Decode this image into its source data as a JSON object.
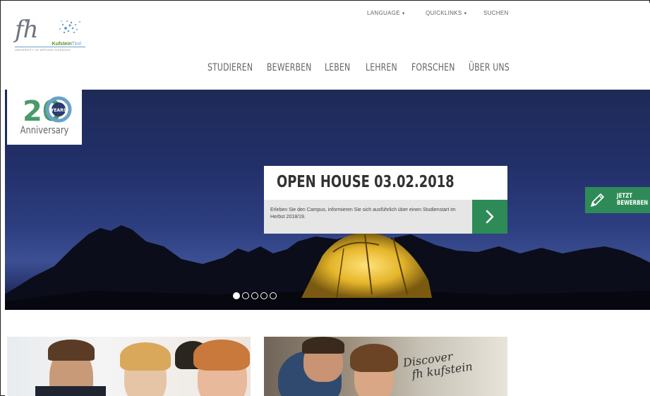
{
  "logo": {
    "mark": "fh",
    "brand_name": "Kufstein",
    "brand_region": "Tirol",
    "tagline": "UNIVERSITY OF APPLIED SCIENCES"
  },
  "utility_nav": {
    "language": "LANGUAGE",
    "quicklinks": "QUICKLINKS",
    "search": "SUCHEN",
    "dropdown_glyph": "▾"
  },
  "main_nav": [
    "STUDIEREN",
    "BEWERBEN",
    "LEBEN",
    "LEHREN",
    "FORSCHEN",
    "ÜBER UNS"
  ],
  "anniversary": {
    "number": "20",
    "years": "YEARS",
    "label": "Anniversary"
  },
  "promo": {
    "title": "OPEN HOUSE 03.02.2018",
    "text": "Erleben Sie den Campus, informieren Sie sich ausführlich über einen Studienstart im Herbst 2018/19.",
    "arrow_icon": "chevron-right-icon"
  },
  "apply_button": {
    "line1": "JETZT",
    "line2": "BEWERBEN",
    "icon": "pencil-icon"
  },
  "carousel": {
    "slide_count": 5,
    "active_index": 0
  },
  "teasers": {
    "discover_line1": "Discover",
    "discover_line2": "fh kufstein"
  },
  "colors": {
    "accent_green": "#2e8b57",
    "hero_navy": "#22306a",
    "text_gray": "#666666"
  }
}
